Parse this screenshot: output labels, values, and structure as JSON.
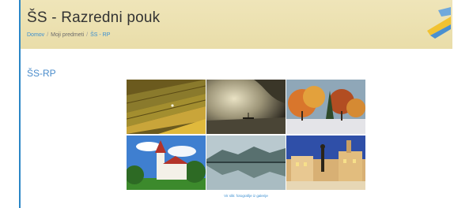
{
  "course": {
    "title": "ŠS - Razredni pouk"
  },
  "breadcrumb": {
    "items": [
      "Domov",
      "Moji predmeti",
      "ŠS - RP"
    ]
  },
  "main": {
    "heading": "ŠS-RP"
  },
  "gallery": {
    "caption": "Vir slik: fotografije iz galerije",
    "photos": [
      "field-photo",
      "lake-boat-photo",
      "autumn-trees-photo",
      "church-photo",
      "lake-reflection-photo",
      "town-square-photo"
    ]
  },
  "colors": {
    "accent": "#2a86c6",
    "header_bg": "#eee3b4",
    "link": "#3a8ed0"
  }
}
